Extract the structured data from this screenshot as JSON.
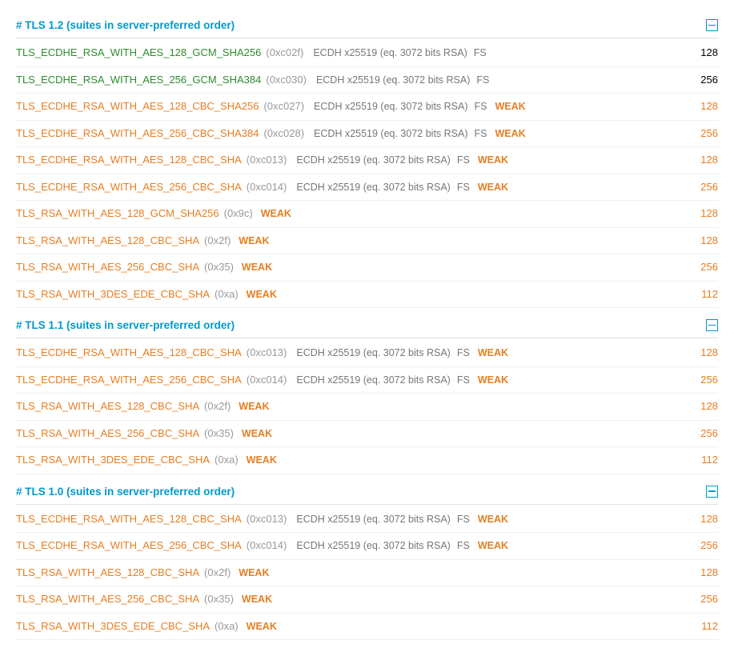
{
  "labels": {
    "weak": "WEAK"
  },
  "sections": [
    {
      "title": "# TLS 1.2 (suites in server-preferred order)",
      "rows": [
        {
          "name": "TLS_ECDHE_RSA_WITH_AES_128_GCM_SHA256",
          "hex": "(0xc02f)",
          "color": "green",
          "kx": "ECDH x25519 (eq. 3072 bits RSA)",
          "fs": "FS",
          "weak": false,
          "bits": "128",
          "bitsColor": "black"
        },
        {
          "name": "TLS_ECDHE_RSA_WITH_AES_256_GCM_SHA384",
          "hex": "(0xc030)",
          "color": "green",
          "kx": "ECDH x25519 (eq. 3072 bits RSA)",
          "fs": "FS",
          "weak": false,
          "bits": "256",
          "bitsColor": "black"
        },
        {
          "name": "TLS_ECDHE_RSA_WITH_AES_128_CBC_SHA256",
          "hex": "(0xc027)",
          "color": "orange",
          "kx": "ECDH x25519 (eq. 3072 bits RSA)",
          "fs": "FS",
          "weak": true,
          "bits": "128",
          "bitsColor": "orange"
        },
        {
          "name": "TLS_ECDHE_RSA_WITH_AES_256_CBC_SHA384",
          "hex": "(0xc028)",
          "color": "orange",
          "kx": "ECDH x25519 (eq. 3072 bits RSA)",
          "fs": "FS",
          "weak": true,
          "bits": "256",
          "bitsColor": "orange"
        },
        {
          "name": "TLS_ECDHE_RSA_WITH_AES_128_CBC_SHA",
          "hex": "(0xc013)",
          "color": "orange",
          "kx": "ECDH x25519 (eq. 3072 bits RSA)",
          "fs": "FS",
          "weak": true,
          "bits": "128",
          "bitsColor": "orange"
        },
        {
          "name": "TLS_ECDHE_RSA_WITH_AES_256_CBC_SHA",
          "hex": "(0xc014)",
          "color": "orange",
          "kx": "ECDH x25519 (eq. 3072 bits RSA)",
          "fs": "FS",
          "weak": true,
          "bits": "256",
          "bitsColor": "orange"
        },
        {
          "name": "TLS_RSA_WITH_AES_128_GCM_SHA256",
          "hex": "(0x9c)",
          "color": "orange",
          "kx": "",
          "fs": "",
          "weak": true,
          "bits": "128",
          "bitsColor": "orange"
        },
        {
          "name": "TLS_RSA_WITH_AES_128_CBC_SHA",
          "hex": "(0x2f)",
          "color": "orange",
          "kx": "",
          "fs": "",
          "weak": true,
          "bits": "128",
          "bitsColor": "orange"
        },
        {
          "name": "TLS_RSA_WITH_AES_256_CBC_SHA",
          "hex": "(0x35)",
          "color": "orange",
          "kx": "",
          "fs": "",
          "weak": true,
          "bits": "256",
          "bitsColor": "orange"
        },
        {
          "name": "TLS_RSA_WITH_3DES_EDE_CBC_SHA",
          "hex": "(0xa)",
          "color": "orange",
          "kx": "",
          "fs": "",
          "weak": true,
          "bits": "112",
          "bitsColor": "orange"
        }
      ]
    },
    {
      "title": "# TLS 1.1 (suites in server-preferred order)",
      "rows": [
        {
          "name": "TLS_ECDHE_RSA_WITH_AES_128_CBC_SHA",
          "hex": "(0xc013)",
          "color": "orange",
          "kx": "ECDH x25519 (eq. 3072 bits RSA)",
          "fs": "FS",
          "weak": true,
          "bits": "128",
          "bitsColor": "orange"
        },
        {
          "name": "TLS_ECDHE_RSA_WITH_AES_256_CBC_SHA",
          "hex": "(0xc014)",
          "color": "orange",
          "kx": "ECDH x25519 (eq. 3072 bits RSA)",
          "fs": "FS",
          "weak": true,
          "bits": "256",
          "bitsColor": "orange"
        },
        {
          "name": "TLS_RSA_WITH_AES_128_CBC_SHA",
          "hex": "(0x2f)",
          "color": "orange",
          "kx": "",
          "fs": "",
          "weak": true,
          "bits": "128",
          "bitsColor": "orange"
        },
        {
          "name": "TLS_RSA_WITH_AES_256_CBC_SHA",
          "hex": "(0x35)",
          "color": "orange",
          "kx": "",
          "fs": "",
          "weak": true,
          "bits": "256",
          "bitsColor": "orange"
        },
        {
          "name": "TLS_RSA_WITH_3DES_EDE_CBC_SHA",
          "hex": "(0xa)",
          "color": "orange",
          "kx": "",
          "fs": "",
          "weak": true,
          "bits": "112",
          "bitsColor": "orange"
        }
      ]
    },
    {
      "title": "# TLS 1.0 (suites in server-preferred order)",
      "rows": [
        {
          "name": "TLS_ECDHE_RSA_WITH_AES_128_CBC_SHA",
          "hex": "(0xc013)",
          "color": "orange",
          "kx": "ECDH x25519 (eq. 3072 bits RSA)",
          "fs": "FS",
          "weak": true,
          "bits": "128",
          "bitsColor": "orange"
        },
        {
          "name": "TLS_ECDHE_RSA_WITH_AES_256_CBC_SHA",
          "hex": "(0xc014)",
          "color": "orange",
          "kx": "ECDH x25519 (eq. 3072 bits RSA)",
          "fs": "FS",
          "weak": true,
          "bits": "256",
          "bitsColor": "orange"
        },
        {
          "name": "TLS_RSA_WITH_AES_128_CBC_SHA",
          "hex": "(0x2f)",
          "color": "orange",
          "kx": "",
          "fs": "",
          "weak": true,
          "bits": "128",
          "bitsColor": "orange"
        },
        {
          "name": "TLS_RSA_WITH_AES_256_CBC_SHA",
          "hex": "(0x35)",
          "color": "orange",
          "kx": "",
          "fs": "",
          "weak": true,
          "bits": "256",
          "bitsColor": "orange"
        },
        {
          "name": "TLS_RSA_WITH_3DES_EDE_CBC_SHA",
          "hex": "(0xa)",
          "color": "orange",
          "kx": "",
          "fs": "",
          "weak": true,
          "bits": "112",
          "bitsColor": "orange"
        }
      ]
    }
  ]
}
